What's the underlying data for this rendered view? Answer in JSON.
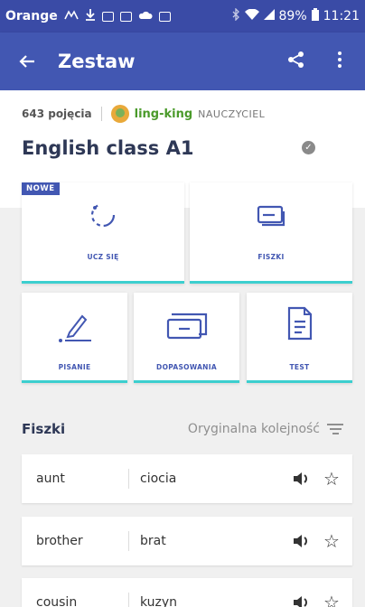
{
  "statusbar": {
    "carrier": "Orange",
    "battery": "89%",
    "time": "11:21"
  },
  "appbar": {
    "back_icon": "arrow-back-icon",
    "title": "Zestaw",
    "share_icon": "share-icon",
    "menu_icon": "more-vert-icon"
  },
  "set": {
    "terms_count": "643 pojęcia",
    "username": "ling-king",
    "role": "NAUCZYCIEL",
    "title": "English class A1",
    "verified_icon": "verified-check-icon"
  },
  "study_modes": [
    {
      "label": "UCZ SIĘ",
      "badge": "NOWE",
      "icon": "learn-circle-icon"
    },
    {
      "label": "FISZKI",
      "icon": "flashcards-icon"
    },
    {
      "label": "PISANIE",
      "icon": "write-pen-icon"
    },
    {
      "label": "DOPASOWANIA",
      "icon": "match-icon"
    },
    {
      "label": "TEST",
      "icon": "test-document-icon"
    }
  ],
  "flashcards": {
    "heading": "Fiszki",
    "sort_label": "Oryginalna kolejność",
    "rows": [
      {
        "term": "aunt",
        "definition": "ciocia"
      },
      {
        "term": "brother",
        "definition": "brat"
      },
      {
        "term": "cousin",
        "definition": "kuzyn"
      }
    ]
  },
  "colors": {
    "primary": "#4257b2",
    "statusbar": "#3a4ba6",
    "accent": "#3ccfcf",
    "username": "#4a9a2a"
  }
}
